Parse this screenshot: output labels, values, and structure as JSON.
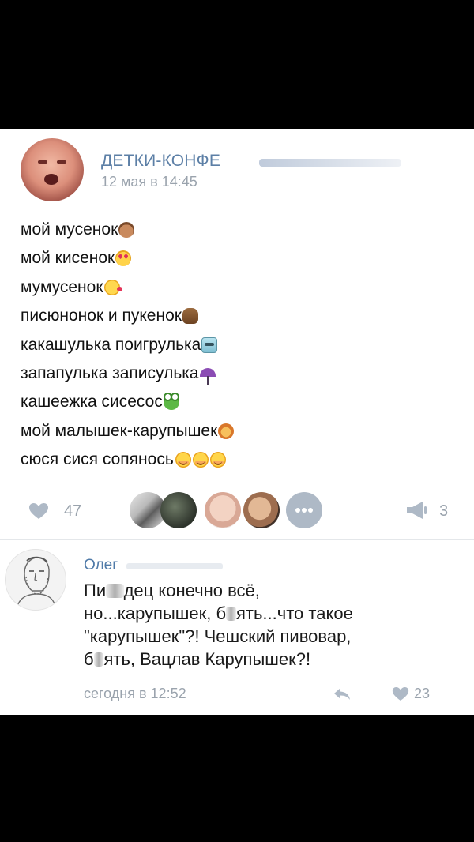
{
  "post": {
    "group_name": "ДЕТКИ-КОНФЕ",
    "time": "12 мая в 14:45",
    "lines": [
      {
        "text": "мой мусенок",
        "emoji": "baby-emoji"
      },
      {
        "text": "мой кисенок",
        "emoji": "heart-eyes-cat-emoji"
      },
      {
        "text": "мумусенок",
        "emoji": "kissing-face-emoji"
      },
      {
        "text": "писюнонок и пукенок",
        "emoji": "poo-emoji"
      },
      {
        "text": "какашулька поигрулька",
        "emoji": "robot-emoji"
      },
      {
        "text": "запапулька записулька",
        "emoji": "umbrella-emoji"
      },
      {
        "text": "кашеежка сисесос",
        "emoji": "frog-emoji"
      },
      {
        "text": "мой малышек-карупышек",
        "emoji": "lion-emoji"
      },
      {
        "text": "сюся сися сопянось",
        "emoji": "blushing-smile-emoji x3"
      }
    ]
  },
  "actions": {
    "likes": "47",
    "shares": "3",
    "liker_avatars": 4
  },
  "comment": {
    "author": "Олег",
    "text_line1_a": "Пи",
    "text_line1_b": "дец конечно всё,",
    "text_line2_a": "но...карупышек, б",
    "text_line2_b": "ять...что такое",
    "text_line3": "\"карупышек\"?! Чешский пивовар,",
    "text_line4_a": "б",
    "text_line4_b": "ять, Вацлав Карупышек?!",
    "time": "сегодня в 12:52",
    "likes": "23"
  },
  "colors": {
    "link": "#5c7fa6",
    "muted": "#9aa3ad",
    "icon": "#aeb9c6"
  }
}
